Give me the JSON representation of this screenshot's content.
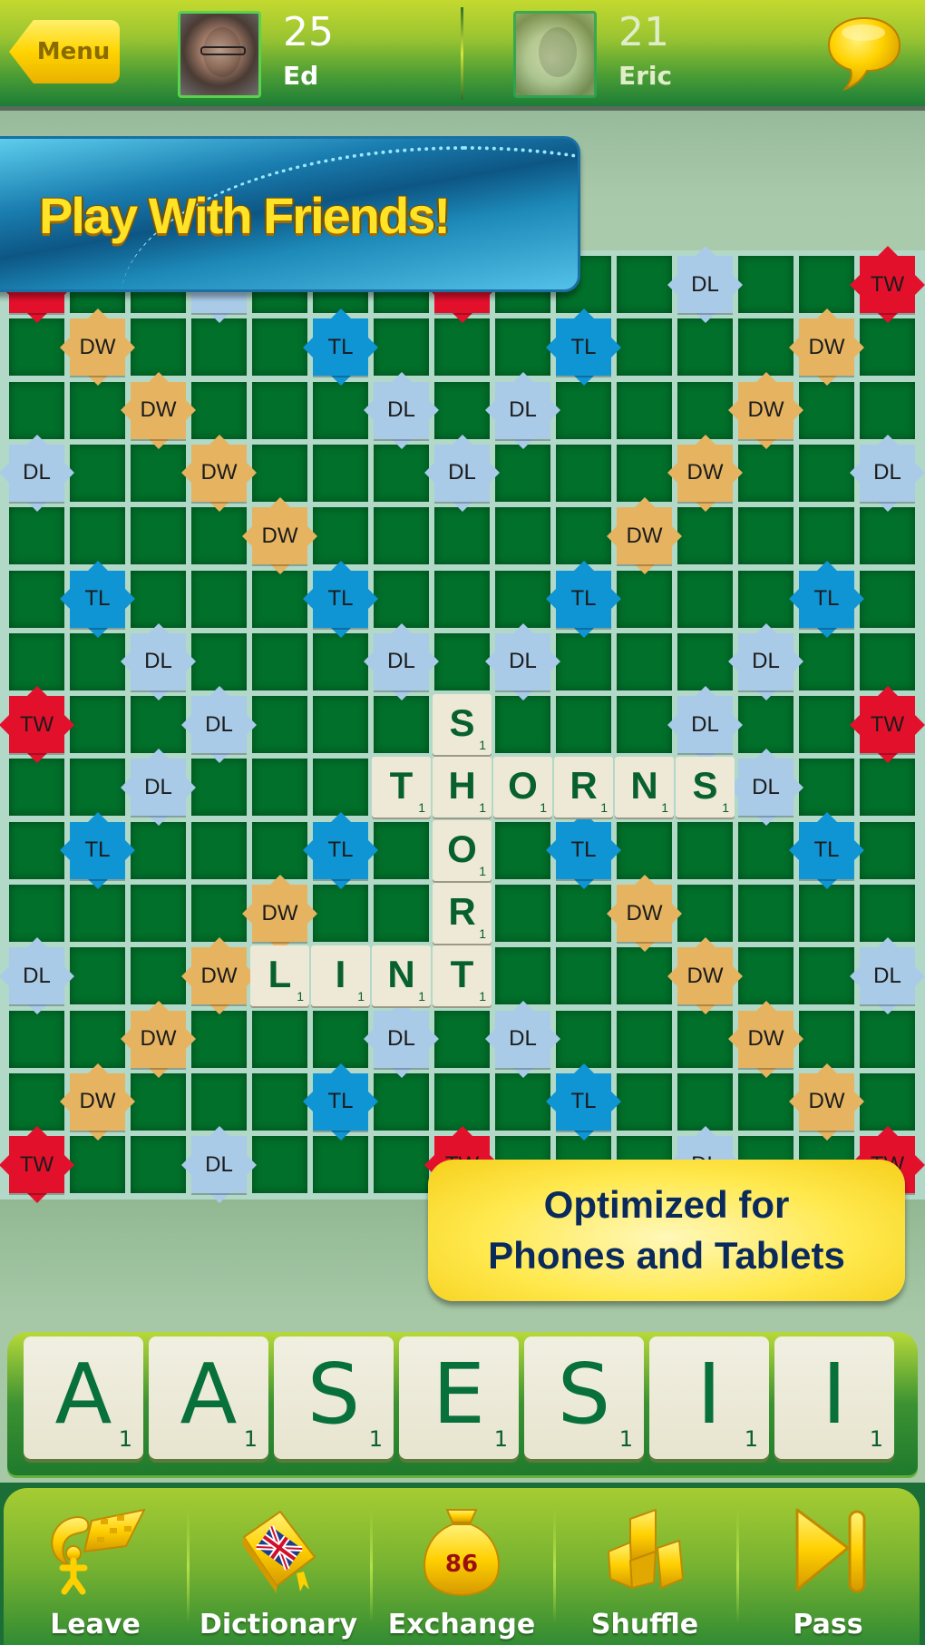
{
  "header": {
    "menu_label": "Menu",
    "players": [
      {
        "name": "Ed",
        "score": "25",
        "active": true
      },
      {
        "name": "Eric",
        "score": "21",
        "active": false
      }
    ],
    "chat_icon": "speech-bubble-icon"
  },
  "banners": {
    "top": "Play With Friends!",
    "bottom_line1": "Optimized for",
    "bottom_line2": "Phones and Tablets"
  },
  "board": {
    "size": 15,
    "colors": {
      "cell": "#00702a",
      "DW": "#e6b461",
      "TW": "#e3102c",
      "DL": "#a9cbe8",
      "TL": "#0f94d4",
      "tile": "#ede9d6",
      "letter": "#08602f"
    },
    "premium": {
      "TW": [
        [
          0,
          0
        ],
        [
          0,
          7
        ],
        [
          0,
          14
        ],
        [
          7,
          0
        ],
        [
          7,
          14
        ],
        [
          14,
          0
        ],
        [
          14,
          7
        ],
        [
          14,
          14
        ]
      ],
      "DW": [
        [
          1,
          1
        ],
        [
          2,
          2
        ],
        [
          3,
          3
        ],
        [
          4,
          4
        ],
        [
          1,
          13
        ],
        [
          2,
          12
        ],
        [
          3,
          11
        ],
        [
          4,
          10
        ],
        [
          13,
          1
        ],
        [
          12,
          2
        ],
        [
          11,
          3
        ],
        [
          10,
          4
        ],
        [
          13,
          13
        ],
        [
          12,
          12
        ],
        [
          11,
          11
        ],
        [
          10,
          10
        ]
      ],
      "TL": [
        [
          1,
          5
        ],
        [
          1,
          9
        ],
        [
          5,
          1
        ],
        [
          5,
          5
        ],
        [
          5,
          9
        ],
        [
          5,
          13
        ],
        [
          9,
          1
        ],
        [
          9,
          5
        ],
        [
          9,
          9
        ],
        [
          9,
          13
        ],
        [
          13,
          5
        ],
        [
          13,
          9
        ]
      ],
      "DL": [
        [
          0,
          3
        ],
        [
          0,
          11
        ],
        [
          2,
          6
        ],
        [
          2,
          8
        ],
        [
          3,
          0
        ],
        [
          3,
          7
        ],
        [
          3,
          14
        ],
        [
          6,
          2
        ],
        [
          6,
          6
        ],
        [
          6,
          8
        ],
        [
          6,
          12
        ],
        [
          7,
          3
        ],
        [
          7,
          11
        ],
        [
          8,
          2
        ],
        [
          8,
          6
        ],
        [
          8,
          8
        ],
        [
          8,
          12
        ],
        [
          11,
          0
        ],
        [
          11,
          7
        ],
        [
          11,
          14
        ],
        [
          12,
          6
        ],
        [
          12,
          8
        ],
        [
          14,
          3
        ],
        [
          14,
          11
        ]
      ]
    },
    "placed_tiles": [
      {
        "letter": "S",
        "points": "1",
        "row": 7,
        "col": 7
      },
      {
        "letter": "T",
        "points": "1",
        "row": 8,
        "col": 6
      },
      {
        "letter": "H",
        "points": "1",
        "row": 8,
        "col": 7
      },
      {
        "letter": "O",
        "points": "1",
        "row": 8,
        "col": 8
      },
      {
        "letter": "R",
        "points": "1",
        "row": 8,
        "col": 9
      },
      {
        "letter": "N",
        "points": "1",
        "row": 8,
        "col": 10
      },
      {
        "letter": "S",
        "points": "1",
        "row": 8,
        "col": 11
      },
      {
        "letter": "O",
        "points": "1",
        "row": 9,
        "col": 7
      },
      {
        "letter": "R",
        "points": "1",
        "row": 10,
        "col": 7
      },
      {
        "letter": "L",
        "points": "1",
        "row": 11,
        "col": 4
      },
      {
        "letter": "I",
        "points": "1",
        "row": 11,
        "col": 5
      },
      {
        "letter": "N",
        "points": "1",
        "row": 11,
        "col": 6
      },
      {
        "letter": "T",
        "points": "1",
        "row": 11,
        "col": 7
      }
    ]
  },
  "rack": [
    {
      "letter": "A",
      "points": "1"
    },
    {
      "letter": "A",
      "points": "1"
    },
    {
      "letter": "S",
      "points": "1"
    },
    {
      "letter": "E",
      "points": "1"
    },
    {
      "letter": "S",
      "points": "1"
    },
    {
      "letter": "I",
      "points": "1"
    },
    {
      "letter": "I",
      "points": "1"
    }
  ],
  "toolbar": {
    "items": [
      {
        "label": "Leave",
        "icon": "leave-game-icon"
      },
      {
        "label": "Dictionary",
        "icon": "dictionary-icon"
      },
      {
        "label": "Exchange",
        "icon": "tile-bag-icon",
        "badge": "86"
      },
      {
        "label": "Shuffle",
        "icon": "shuffle-icon"
      },
      {
        "label": "Pass",
        "icon": "pass-icon"
      }
    ]
  }
}
